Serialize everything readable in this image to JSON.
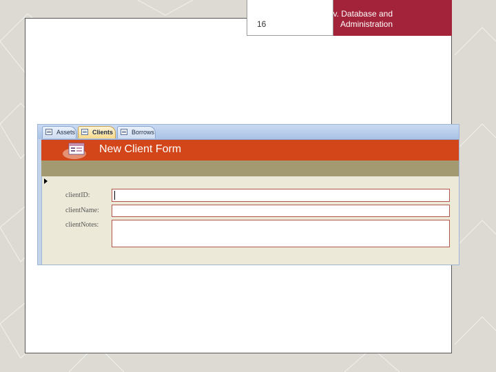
{
  "slide": {
    "page_number": "16",
    "title_line1": "Adv. Database and",
    "title_line2": "Administration"
  },
  "access": {
    "tabs": [
      {
        "label": "Assets",
        "icon": "form-icon",
        "active": false
      },
      {
        "label": "Clients",
        "icon": "form-icon",
        "active": true
      },
      {
        "label": "Borrows",
        "icon": "form-icon",
        "active": false
      }
    ],
    "form": {
      "title": "New Client Form",
      "header_color": "#d3461a",
      "band_color": "#a39a72",
      "fields": [
        {
          "label": "clientID:",
          "value": ""
        },
        {
          "label": "clientName:",
          "value": ""
        },
        {
          "label": "clientNotes:",
          "value": ""
        }
      ]
    }
  },
  "colors": {
    "title_bar": "#a3233a",
    "slide_background": "#dcdad2"
  }
}
